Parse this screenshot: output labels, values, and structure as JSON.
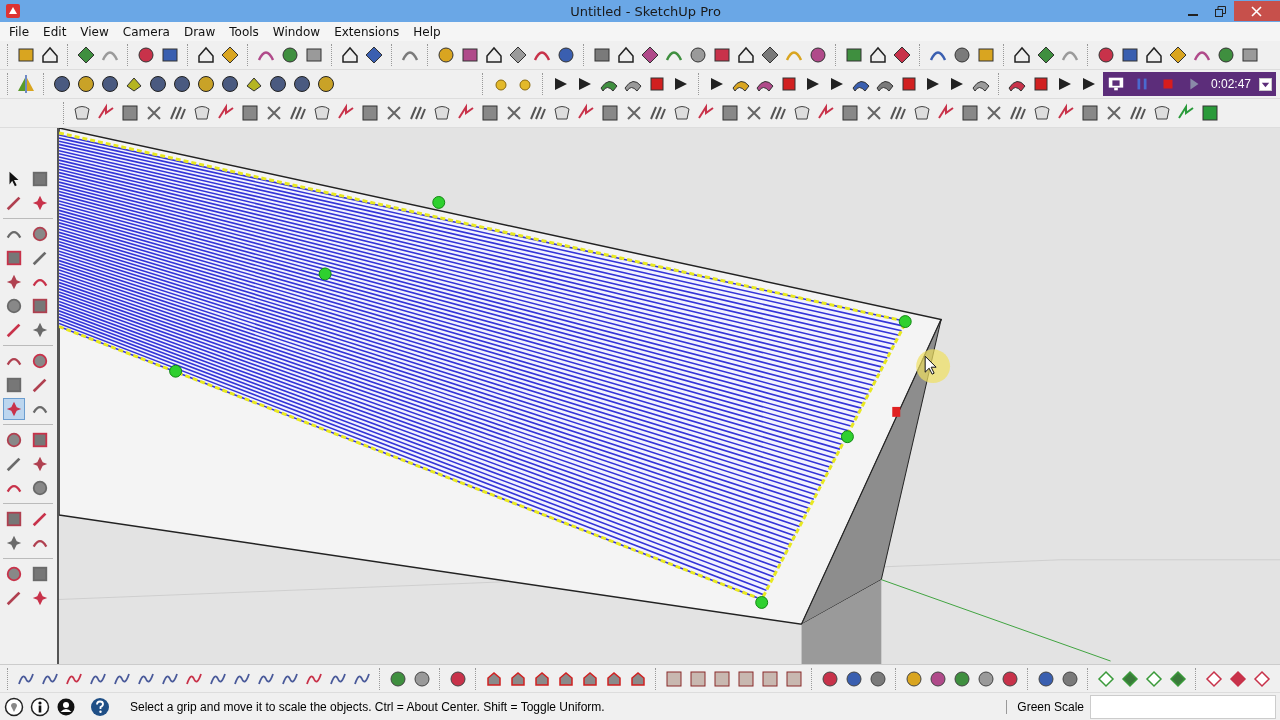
{
  "window": {
    "title": "Untitled - SketchUp Pro"
  },
  "menu": [
    "File",
    "Edit",
    "View",
    "Camera",
    "Draw",
    "Tools",
    "Window",
    "Extensions",
    "Help"
  ],
  "recorder": {
    "time": "0:02:47"
  },
  "tool_palette": [
    {
      "selected": false
    },
    {
      "selected": false
    },
    {
      "selected": false
    },
    {
      "selected": false
    },
    {
      "selected": false
    },
    {
      "selected": false
    },
    {
      "selected": false
    },
    {
      "selected": false
    },
    {
      "selected": false
    },
    {
      "selected": false
    },
    {
      "selected": false
    },
    {
      "selected": false
    },
    {
      "selected": false
    },
    {
      "selected": false
    },
    {
      "selected": false
    },
    {
      "selected": false
    },
    {
      "selected": false
    },
    {
      "selected": false
    },
    {
      "selected": true
    },
    {
      "selected": false
    },
    {
      "selected": false
    },
    {
      "selected": false
    },
    {
      "selected": false
    },
    {
      "selected": false
    },
    {
      "selected": false
    },
    {
      "selected": false
    },
    {
      "selected": false
    },
    {
      "selected": false
    },
    {
      "selected": false
    },
    {
      "selected": false
    },
    {
      "selected": false
    },
    {
      "selected": false
    },
    {
      "selected": false
    },
    {
      "selected": false
    }
  ],
  "status_bar": {
    "hint": "Select a grip and move it to scale the objects. Ctrl = About Center. Shift = Toggle Uniform.",
    "measurement_label": "Green Scale"
  }
}
